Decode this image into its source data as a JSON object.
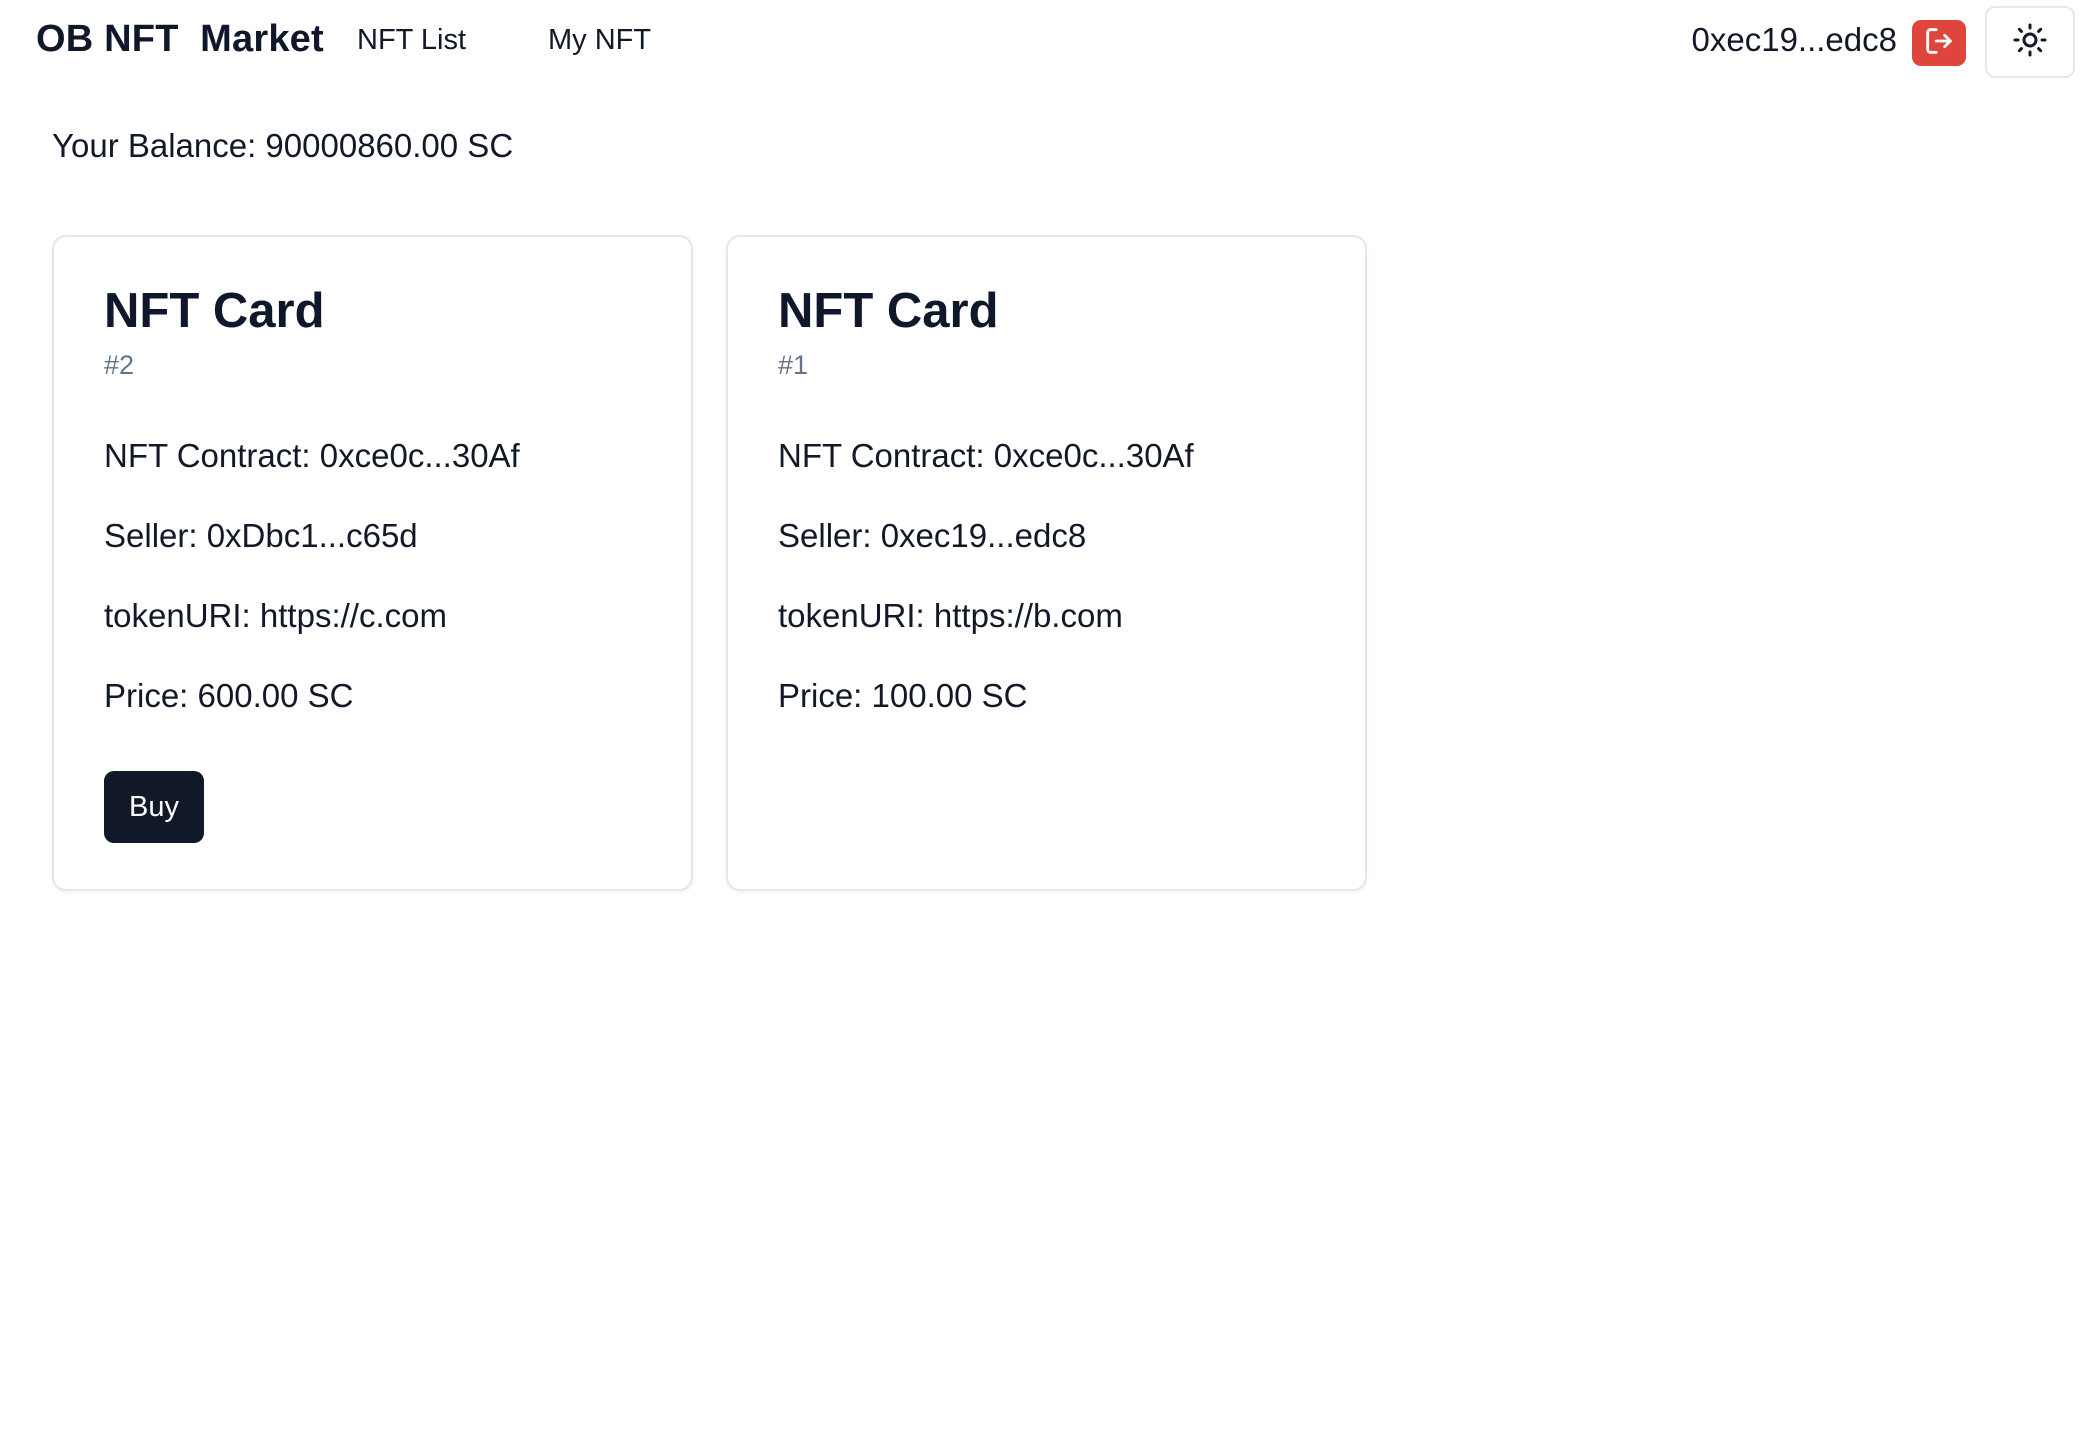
{
  "header": {
    "brand": "OB NFT  Market",
    "nav": [
      "NFT List",
      "My NFT"
    ],
    "address": "0xec19...edc8",
    "logout_icon": "logout-icon",
    "theme_icon": "sun-icon",
    "colors": {
      "logout": "#e0453d",
      "primary": "#111827"
    }
  },
  "balance": "Your Balance: 90000860.00 SC",
  "cards": [
    {
      "title": "NFT Card",
      "id": "#2",
      "contract": "NFT Contract: 0xce0c...30Af",
      "seller": "Seller: 0xDbc1...c65d",
      "token_uri": "tokenURI: https://c.com",
      "price": "Price: 600.00 SC",
      "buy_label": "Buy"
    },
    {
      "title": "NFT Card",
      "id": "#1",
      "contract": "NFT Contract: 0xce0c...30Af",
      "seller": "Seller: 0xec19...edc8",
      "token_uri": "tokenURI: https://b.com",
      "price": "Price: 100.00 SC"
    }
  ]
}
